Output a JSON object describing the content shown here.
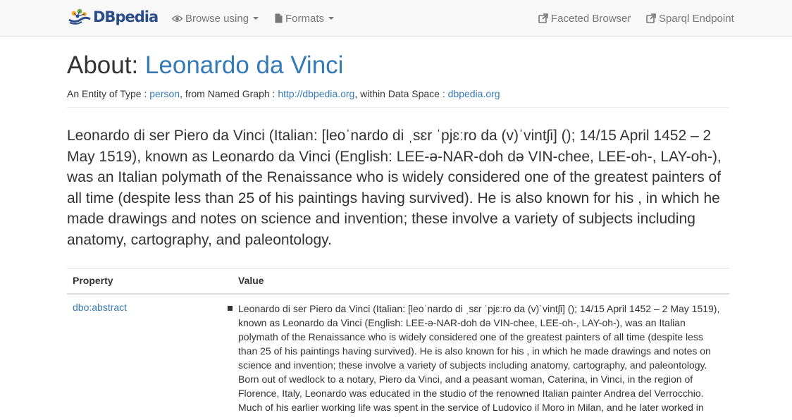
{
  "navbar": {
    "brand": "DBpedia",
    "browse_label": "Browse using",
    "formats_label": "Formats",
    "faceted_label": "Faceted Browser",
    "sparql_label": "Sparql Endpoint"
  },
  "header": {
    "about_prefix": "About: ",
    "title": "Leonardo da Vinci"
  },
  "entity": {
    "prefix": "An Entity of Type : ",
    "type_link": "person",
    "graph_prefix": ", from Named Graph : ",
    "graph_link": "http://dbpedia.org",
    "space_prefix": ", within Data Space : ",
    "space_link": "dbpedia.org"
  },
  "lead": "Leonardo di ser Piero da Vinci (Italian: [leoˈnardo di ˌsɛr ˈpjɛːro da (v)ˈvintʃi] (); 14/15 April 1452 – 2 May 1519), known as Leonardo da Vinci (English: LEE-ə-NAR-doh də VIN-chee, LEE-oh-, LAY-oh-), was an Italian polymath of the Renaissance who is widely considered one of the greatest painters of all time (despite less than 25 of his paintings having survived). He is also known for his , in which he made drawings and notes on science and invention; these involve a variety of subjects including anatomy, cartography, and paleontology.",
  "table": {
    "headers": [
      "Property",
      "Value"
    ],
    "rows": [
      {
        "property": "dbo:abstract",
        "value": "Leonardo di ser Piero da Vinci (Italian: [leoˈnardo di ˌsɛr ˈpjɛːro da (v)ˈvintʃi] (); 14/15 April 1452 – 2 May 1519), known as Leonardo da Vinci (English: LEE-ə-NAR-doh də VIN-chee, LEE-oh-, LAY-oh-), was an Italian polymath of the Renaissance who is widely considered one of the greatest painters of all time (despite less than 25 of his paintings having survived). He is also known for his , in which he made drawings and notes on science and invention; these involve a variety of subjects including anatomy, cartography, and paleontology. Born out of wedlock to a notary, Piero da Vinci, and a peasant woman, Caterina, in Vinci, in the region of Florence, Italy, Leonardo was educated in the studio of the renowned Italian painter Andrea del Verrocchio. Much of his earlier working life was spent in the service of Ludovico il Moro in Milan, and he later worked in"
      }
    ]
  },
  "colors": {
    "link": "#337ab7",
    "navbar_bg": "#f8f8f8",
    "brand_blue": "#2b4c8a",
    "brand_orange": "#f7a21b",
    "brand_green": "#6fb13f"
  },
  "icons": {
    "browse": "eye-icon",
    "formats": "file-icon",
    "faceted": "external-link-icon",
    "sparql": "external-link-icon"
  }
}
